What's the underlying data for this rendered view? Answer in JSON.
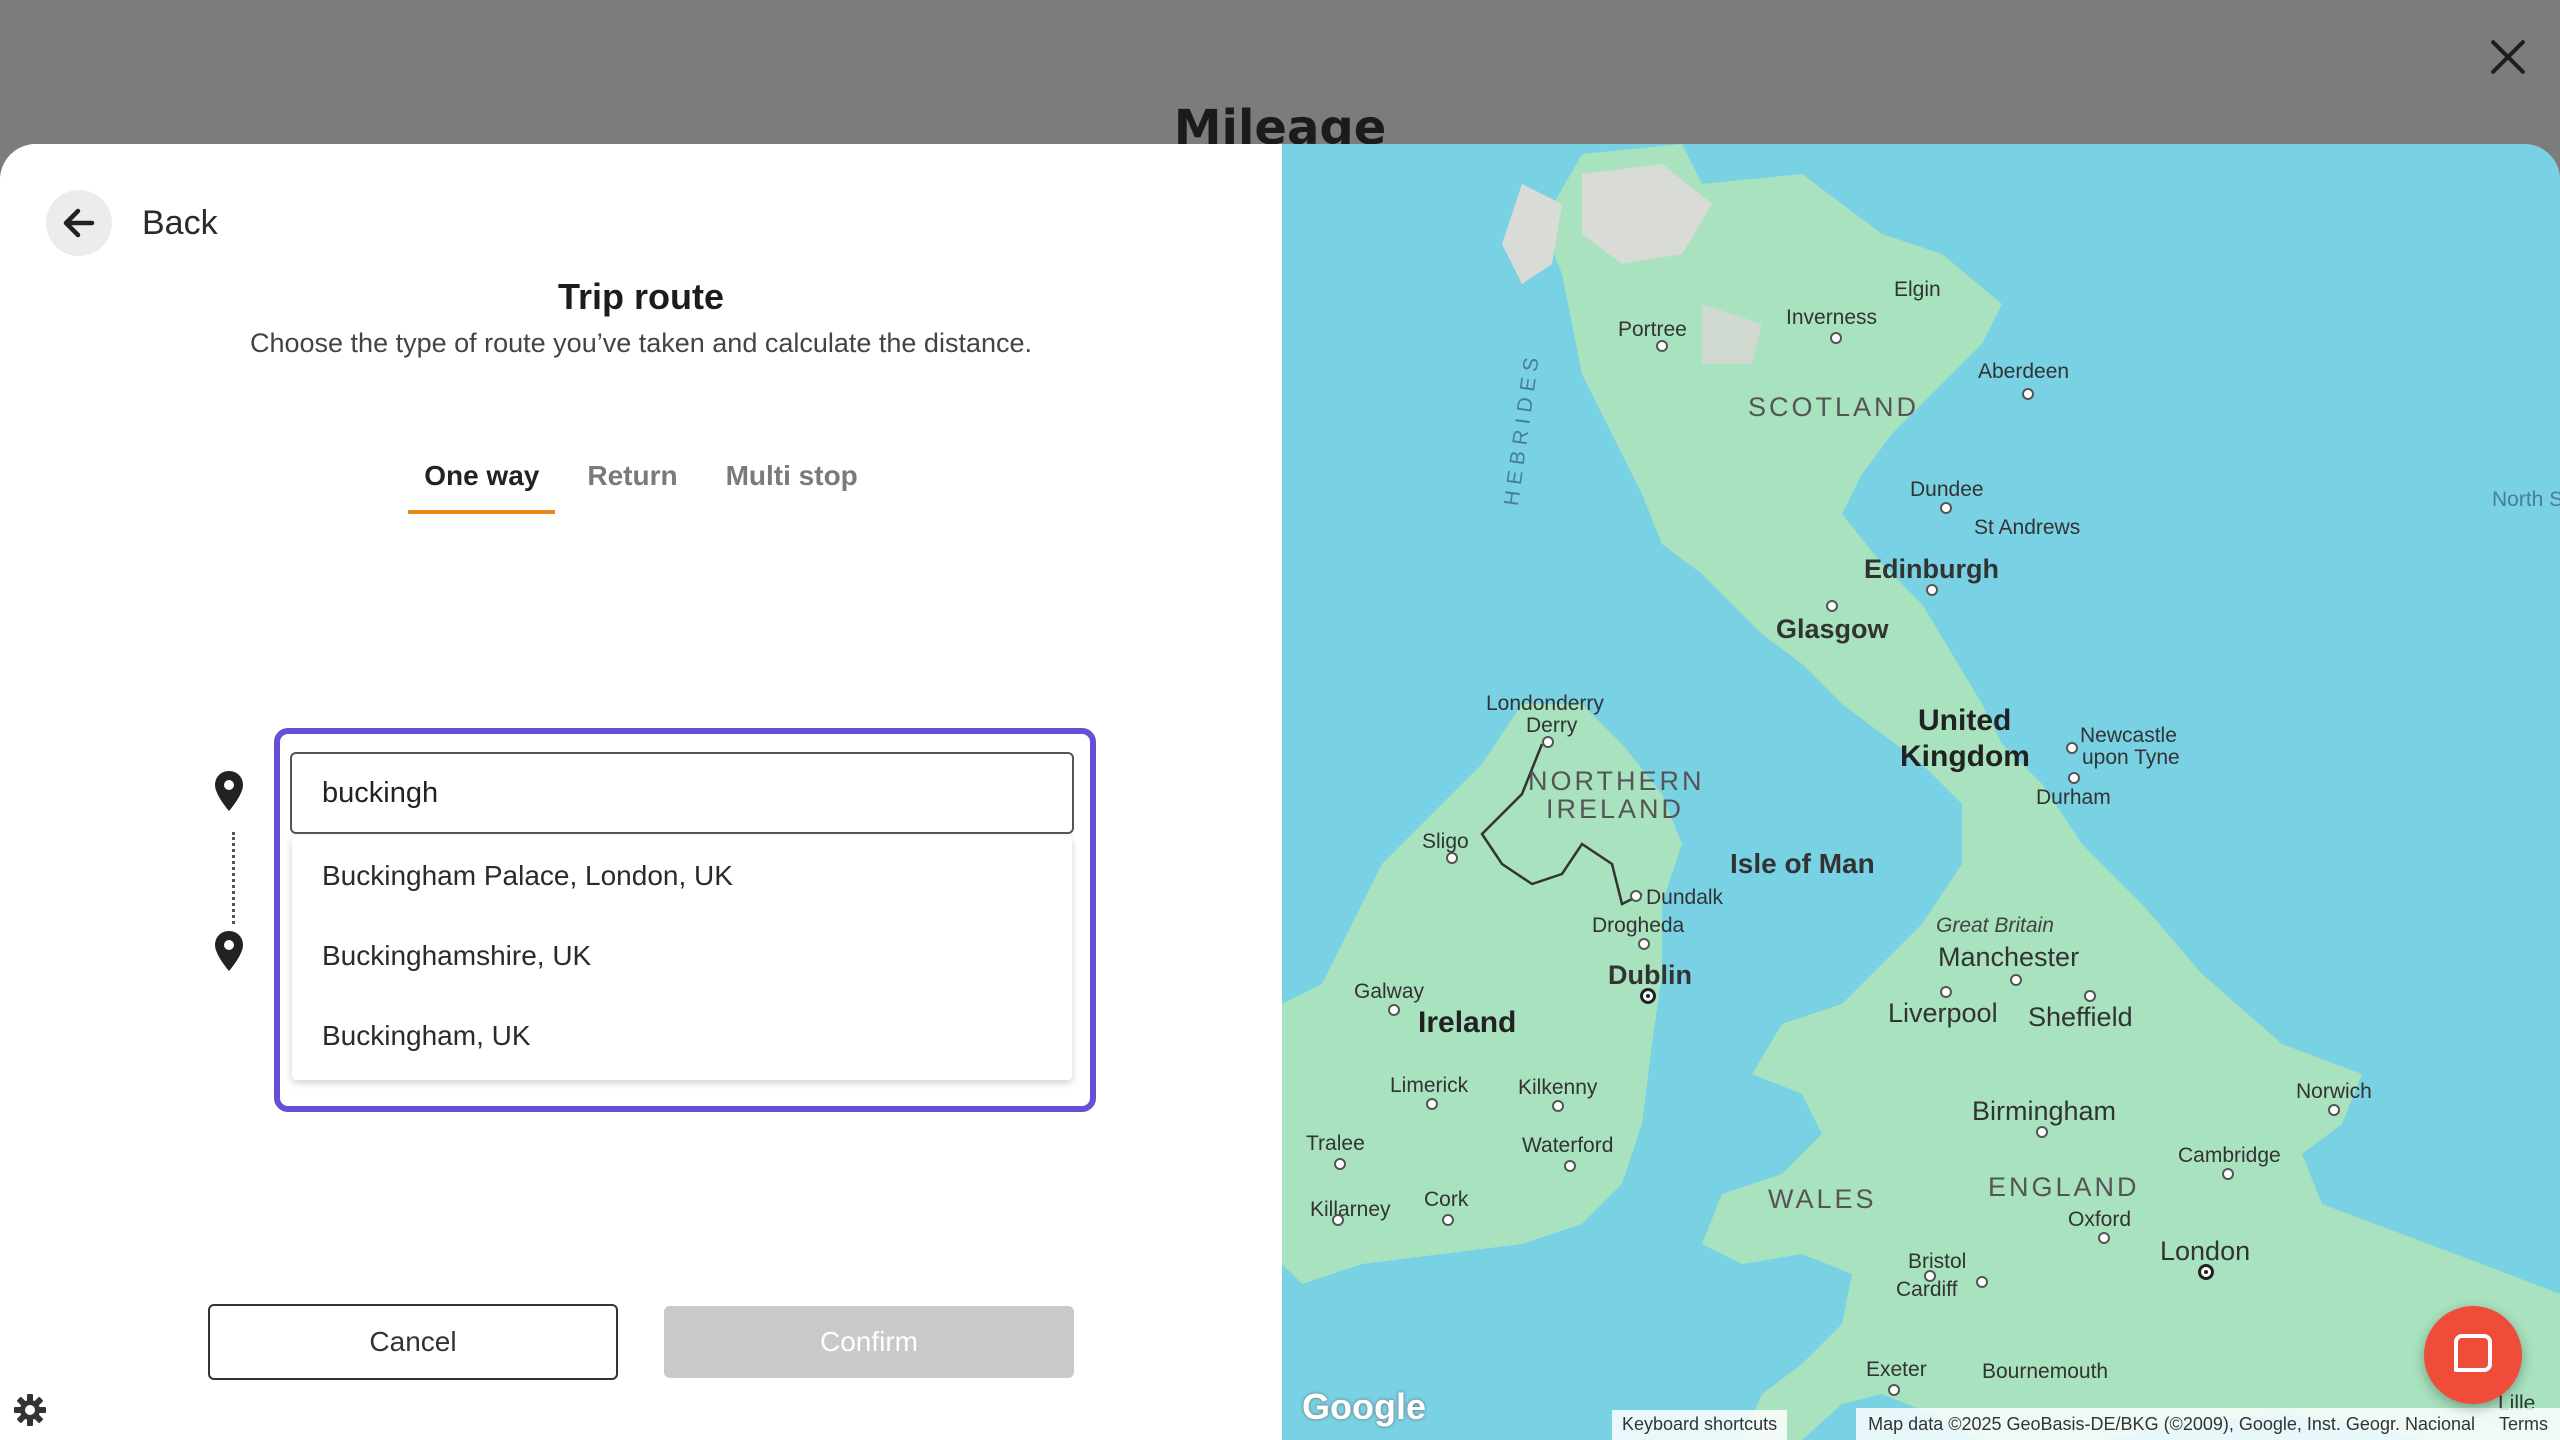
{
  "backdrop": {
    "title": "Mileage"
  },
  "modal": {
    "back_label": "Back",
    "title": "Trip route",
    "subtitle": "Choose the type of route you’ve taken and calculate the distance.",
    "tabs": [
      {
        "label": "One way",
        "active": true
      },
      {
        "label": "Return",
        "active": false
      },
      {
        "label": "Multi stop",
        "active": false
      }
    ],
    "search": {
      "value": "buckingh"
    },
    "suggestions": [
      "Buckingham Palace, London, UK",
      "Buckinghamshire, UK",
      "Buckingham, UK"
    ],
    "cancel_label": "Cancel",
    "confirm_label": "Confirm"
  },
  "colors": {
    "accent_tab": "#e8891b",
    "focus_ring": "#6a4fd6",
    "confirm_disabled": "#c9c9c9",
    "chat_button": "#ef4c3a",
    "sea": "#79d1e4",
    "land": "#a8e2bf"
  },
  "map": {
    "labels": {
      "elgin": "Elgin",
      "portree": "Portree",
      "inverness": "Inverness",
      "aberdeen": "Aberdeen",
      "hebrides": "HEBRIDES",
      "scotland": "SCOTLAND",
      "north_sea": "North S",
      "dundee": "Dundee",
      "st_andrews": "St Andrews",
      "edinburgh": "Edinburgh",
      "glasgow": "Glasgow",
      "londonderry": "Londonderry",
      "derry": "Derry",
      "united_kingdom_1": "United",
      "united_kingdom_2": "Kingdom",
      "newcastle_1": "Newcastle",
      "newcastle_2": "upon Tyne",
      "northern_ireland_1": "NORTHERN",
      "northern_ireland_2": "IRELAND",
      "durham": "Durham",
      "sligo": "Sligo",
      "isle_of_man": "Isle of Man",
      "dundalk": "Dundalk",
      "drogheda": "Drogheda",
      "great_britain": "Great Britain",
      "manchester": "Manchester",
      "dublin": "Dublin",
      "galway": "Galway",
      "ireland": "Ireland",
      "liverpool": "Liverpool",
      "sheffield": "Sheffield",
      "limerick": "Limerick",
      "kilkenny": "Kilkenny",
      "norwich": "Norwich",
      "birmingham": "Birmingham",
      "tralee": "Tralee",
      "waterford": "Waterford",
      "cambridge": "Cambridge",
      "england": "ENGLAND",
      "killarney": "Killarney",
      "cork": "Cork",
      "wales": "WALES",
      "oxford": "Oxford",
      "london": "London",
      "bristol": "Bristol",
      "cardiff": "Cardiff",
      "exeter": "Exeter",
      "bournemouth": "Bournemouth",
      "lille": "Lille"
    },
    "google_logo": "Google",
    "keyboard_shortcuts": "Keyboard shortcuts",
    "map_data": "Map data ©2025 GeoBasis-DE/BKG (©2009), Google, Inst. Geogr. Nacional",
    "terms": "Terms"
  },
  "icons": {
    "close": "close-icon",
    "back": "arrow-left-icon",
    "pin": "map-pin-icon",
    "gear": "gear-icon",
    "chat": "chat-icon"
  }
}
